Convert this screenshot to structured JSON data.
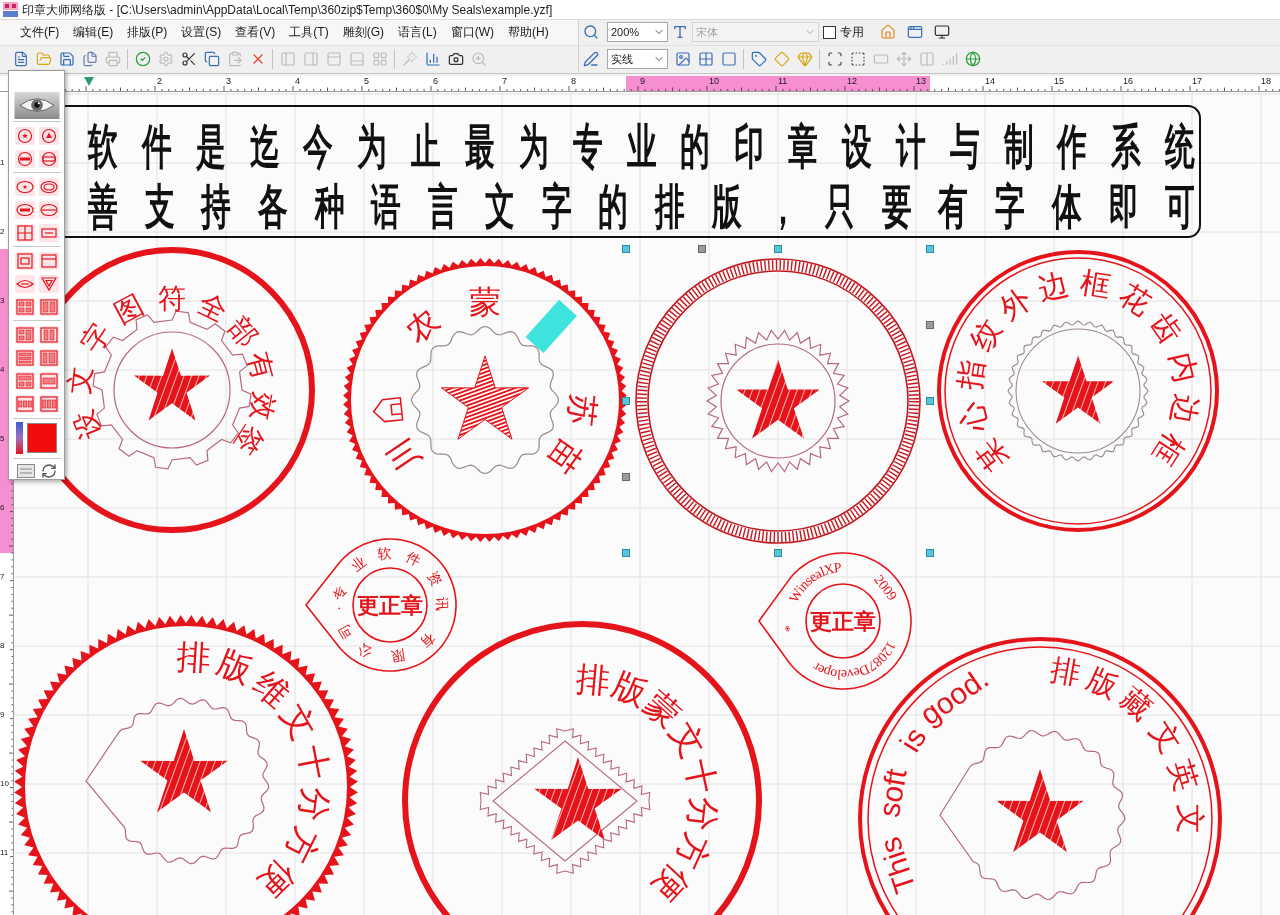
{
  "window": {
    "title": "印章大师网络版 - [C:\\Users\\admin\\AppData\\Local\\Temp\\360zip$Temp\\360$0\\My Seals\\example.yzf]"
  },
  "menu": [
    "文件(F)",
    "编辑(E)",
    "排版(P)",
    "设置(S)",
    "查看(V)",
    "工具(T)",
    "雕刻(G)",
    "语言(L)",
    "窗口(W)",
    "帮助(H)"
  ],
  "toolbar": {
    "buttons": [
      {
        "disabled": false
      },
      {
        "disabled": false
      },
      {
        "disabled": false
      },
      {
        "disabled": false
      },
      {
        "disabled": true
      },
      {
        "disabled": false
      },
      {
        "disabled": true
      },
      {
        "disabled": false
      },
      {
        "disabled": false
      },
      {
        "disabled": true
      },
      {
        "disabled": false
      },
      {
        "disabled": true
      },
      {
        "disabled": true
      },
      {
        "disabled": true
      },
      {
        "disabled": true
      },
      {
        "disabled": true
      },
      {
        "disabled": true
      },
      {
        "disabled": false
      },
      {
        "disabled": false
      },
      {
        "disabled": true
      }
    ]
  },
  "format_bar": {
    "zoom": "200%",
    "font": {
      "value": "宋体",
      "disabled": true
    },
    "dedicated": {
      "label": "专用",
      "checked": false
    },
    "buttons": [
      {
        "disabled": false
      },
      {
        "disabled": false
      },
      {
        "disabled": false
      }
    ],
    "line_style": "实线",
    "tools": [
      {
        "disabled": false
      },
      {
        "disabled": false
      },
      {
        "disabled": false
      },
      {
        "disabled": false
      },
      {
        "disabled": false
      },
      {
        "disabled": false
      },
      {
        "disabled": false
      },
      {
        "disabled": false
      },
      {
        "disabled": true
      },
      {
        "disabled": true
      },
      {
        "disabled": true
      },
      {
        "disabled": true
      },
      {
        "disabled": false
      }
    ]
  },
  "rulers": {
    "horizontal": [
      "2",
      "3",
      "4",
      "5",
      "6",
      "7",
      "8",
      "9",
      "10",
      "11",
      "12",
      "13",
      "14",
      "15",
      "16",
      "17",
      "18"
    ],
    "vertical": [
      "1",
      "2",
      "3",
      "4",
      "5",
      "6",
      "7",
      "8",
      "9",
      "10",
      "11"
    ]
  },
  "banner": {
    "lines": [
      "软件是迄今为止最为专业的印章设计与制作系统",
      "善支持各种语言文字的排版，只要有字体即可"
    ]
  },
  "seals": [
    {
      "kind": "gear",
      "selected": false,
      "characters": [
        "设",
        "文",
        "字",
        "图",
        "符",
        "全",
        "部",
        "有",
        "效",
        "签"
      ]
    },
    {
      "kind": "scalloped",
      "selected": false,
      "characters": [
        "川",
        "农",
        "蒙",
        "苏",
        "苗"
      ]
    },
    {
      "kind": "hatched",
      "selected": true
    },
    {
      "kind": "fingerprint",
      "selected": false,
      "characters": [
        "某",
        "心",
        "指",
        "纹",
        "外",
        "边",
        "框",
        "花",
        "齿",
        "内",
        "边",
        "框"
      ]
    },
    {
      "kind": "badge",
      "selected": false,
      "characters": [
        "专",
        "业",
        "软",
        "件",
        "资",
        "讯",
        "有",
        "限",
        "公",
        "司",
        "·"
      ],
      "center_text": "更正章"
    },
    {
      "kind": "badge",
      "selected": false,
      "words": [
        "WinsealXP",
        "2009",
        "12087Developer",
        "*"
      ],
      "center_text": "更正章"
    },
    {
      "kind": "sawtooth",
      "selected": false,
      "characters": [
        "排",
        "版",
        "维",
        "文",
        "十",
        "分",
        "方",
        "便"
      ]
    },
    {
      "kind": "diamond",
      "selected": false,
      "characters": [
        "排",
        "版",
        "蒙",
        "文",
        "十",
        "分",
        "方",
        "便"
      ]
    },
    {
      "kind": "double",
      "selected": false,
      "words": [
        "This",
        "soft",
        "is",
        "good.",
        "排",
        "版",
        "藏",
        "文",
        "英",
        "文"
      ]
    }
  ]
}
